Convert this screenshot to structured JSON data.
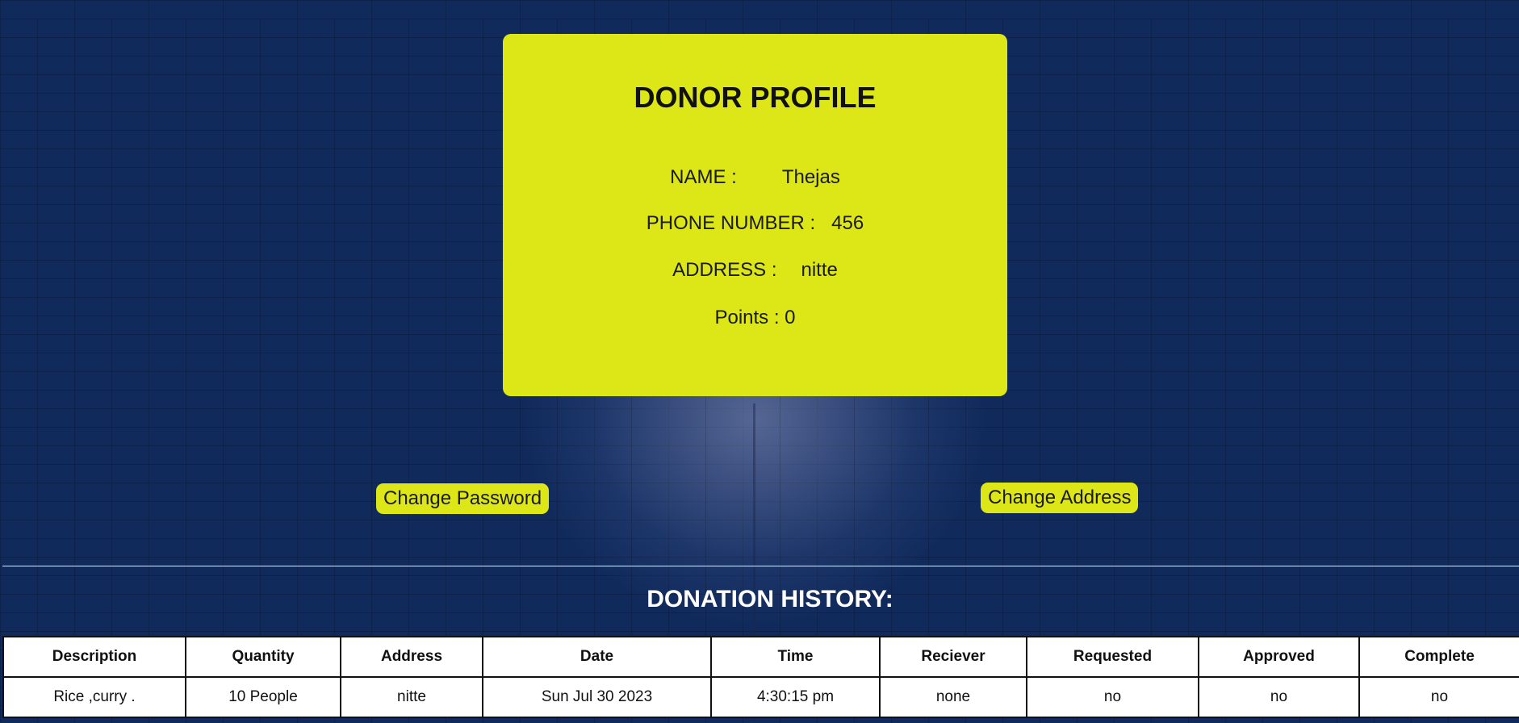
{
  "profile": {
    "title": "DONOR PROFILE",
    "name_label": "NAME :",
    "name_value": "Thejas",
    "phone_label": "PHONE NUMBER :",
    "phone_value": "456",
    "address_label": "ADDRESS :",
    "address_value": "nitte",
    "points_text": "Points : 0"
  },
  "actions": {
    "change_password": "Change Password",
    "change_address": "Change Address"
  },
  "history": {
    "title": "DONATION HISTORY:",
    "columns": [
      "Description",
      "Quantity",
      "Address",
      "Date",
      "Time",
      "Reciever",
      "Requested",
      "Approved",
      "Complete"
    ],
    "rows": [
      [
        "Rice ,curry .",
        "10 People",
        "nitte",
        "Sun Jul 30 2023",
        "4:30:15 pm",
        "none",
        "no",
        "no",
        "no"
      ]
    ]
  },
  "colors": {
    "card_bg": "#dde616",
    "page_bg": "#102a5c",
    "table_bg": "#ffffff"
  }
}
